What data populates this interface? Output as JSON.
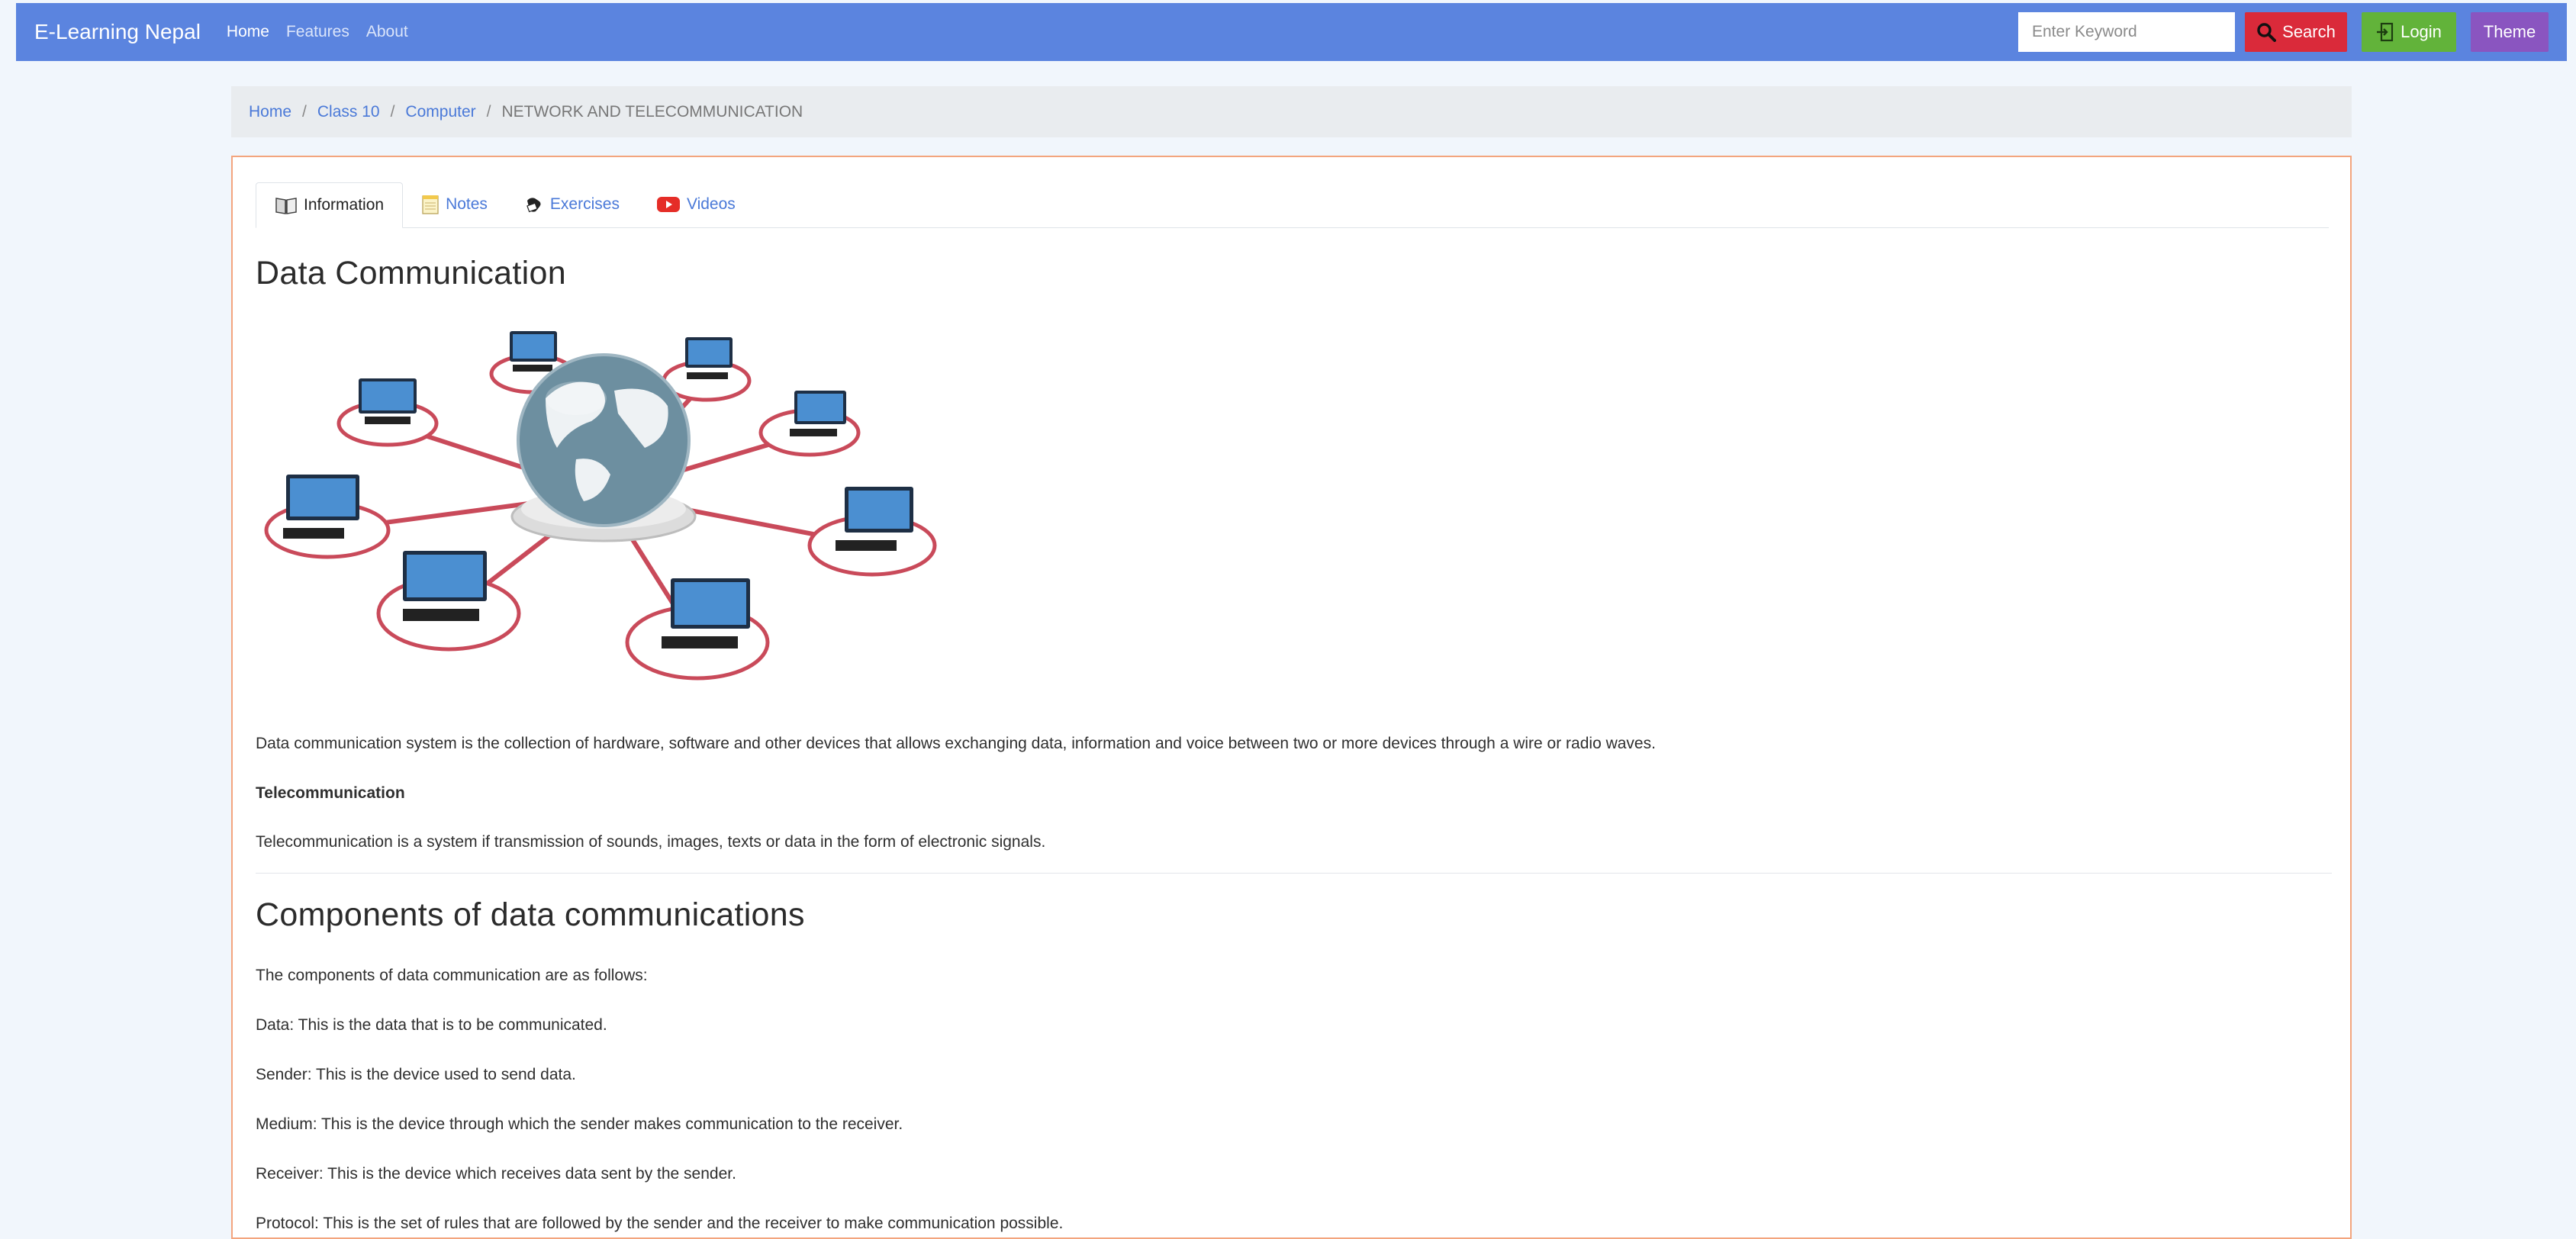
{
  "navbar": {
    "brand": "E-Learning Nepal",
    "links": [
      "Home",
      "Features",
      "About"
    ],
    "search_placeholder": "Enter Keyword",
    "search_label": "Search",
    "login_label": "Login",
    "theme_label": "Theme",
    "color": "#5b84df"
  },
  "breadcrumb": {
    "items": [
      "Home",
      "Class 10",
      "Computer"
    ],
    "current": "NETWORK AND TELECOMMUNICATION"
  },
  "tabs": [
    "Information",
    "Notes",
    "Exercises",
    "Videos"
  ],
  "article": {
    "title": "Data Communication",
    "intro": "Data communication system is the collection of hardware, software and other devices that allows exchanging data, information and voice between two or more devices through a wire or radio waves.",
    "telecom_heading": "Telecommunication",
    "telecom_text": "Telecommunication is a system if transmission of sounds, images, texts or data in the form of electronic signals.",
    "components_title": "Components of data communications",
    "components_intro": "The components of data communication are as follows:",
    "components": [
      "Data: This is the data that is to be communicated.",
      "Sender: This is the device used to send data.",
      "Medium: This is the device through which the sender makes communication to the receiver.",
      "Receiver: This is the device which receives data sent by the sender.",
      "Protocol: This is the set of rules that are followed by the sender and the receiver to make communication possible."
    ]
  }
}
